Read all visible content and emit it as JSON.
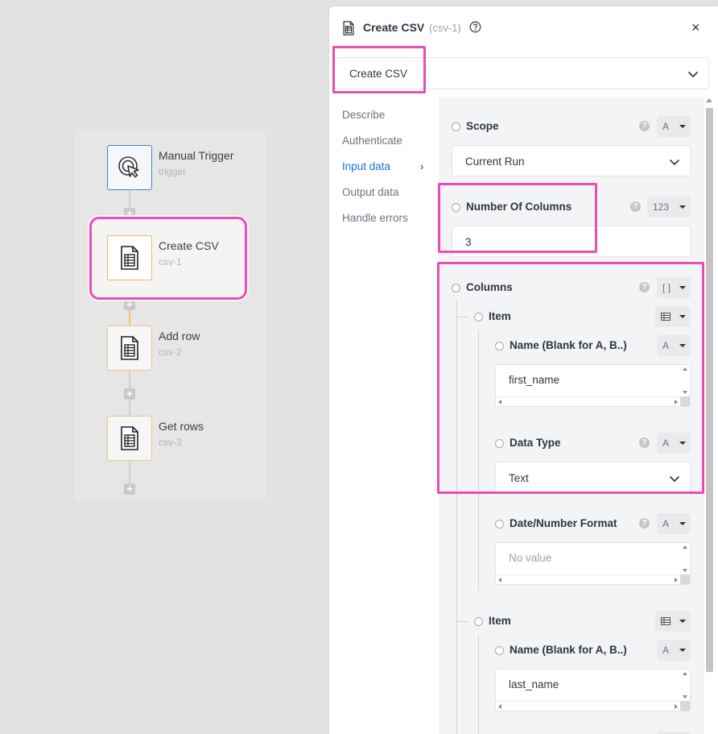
{
  "workflow": {
    "nodes": [
      {
        "title": "Manual Trigger",
        "subtitle": "trigger",
        "icon": "cursor-click-icon"
      },
      {
        "title": "Create CSV",
        "subtitle": "csv-1",
        "icon": "spreadsheet-icon",
        "selected": true
      },
      {
        "title": "Add row",
        "subtitle": "csv-2",
        "icon": "spreadsheet-icon"
      },
      {
        "title": "Get rows",
        "subtitle": "csv-3",
        "icon": "spreadsheet-icon"
      }
    ],
    "add_step_symbol": "+"
  },
  "panel": {
    "title": "Create CSV",
    "id": "(csv-1)",
    "help_symbol": "?",
    "close_symbol": "×",
    "name_select_value": "Create CSV",
    "nav": [
      "Describe",
      "Authenticate",
      "Input data",
      "Output data",
      "Handle errors"
    ],
    "nav_active": "Input data",
    "nav_arrow": "›"
  },
  "fields": {
    "scope": {
      "label": "Scope",
      "type": "A",
      "value": "Current Run"
    },
    "num_columns": {
      "label": "Number Of Columns",
      "type": "123",
      "value": "3"
    },
    "columns": {
      "label": "Columns",
      "type": "[ ]",
      "items": [
        {
          "label": "Item",
          "name_label": "Name (Blank for A, B..)",
          "name_type": "A",
          "name_value": "first_name",
          "data_type_label": "Data Type",
          "data_type_type": "A",
          "data_type_value": "Text",
          "format_label": "Date/Number Format",
          "format_type": "A",
          "format_placeholder": "No value"
        },
        {
          "label": "Item",
          "name_label": "Name (Blank for A, B..)",
          "name_type": "A",
          "name_value": "last_name"
        }
      ]
    }
  },
  "colors": {
    "highlight": "#e84fb4",
    "accent": "#1e6fd9",
    "node_border": "#f0c48a",
    "trigger_border": "#4a7fd0"
  }
}
